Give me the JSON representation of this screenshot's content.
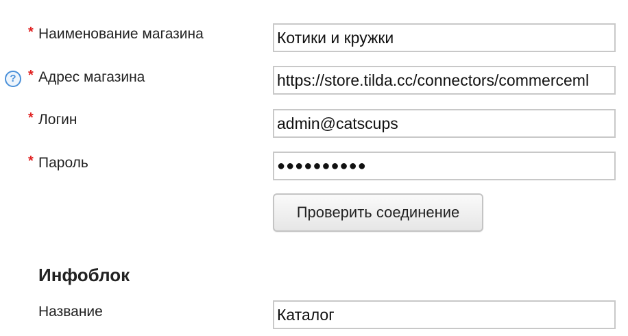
{
  "form": {
    "fields": [
      {
        "label": "Наименование магазина",
        "required": true,
        "value": "Котики и кружки"
      },
      {
        "label": "Адрес магазина",
        "required": true,
        "value": "https://store.tilda.cc/connectors/commerceml"
      },
      {
        "label": "Логин",
        "required": true,
        "value": "admin@catscups"
      },
      {
        "label": "Пароль",
        "required": true,
        "value": "●●●●●●●●●●"
      }
    ],
    "required_mark": "*",
    "help_icon_glyph": "?",
    "check_button_label": "Проверить соединение"
  },
  "infoblock": {
    "title": "Инфоблок",
    "name_label": "Название",
    "name_value": "Каталог"
  },
  "colors": {
    "required": "#e02020",
    "help_icon": "#4a90d9",
    "field_border": "#c8c8c8"
  },
  "icons": {
    "help": "question-circle-icon"
  }
}
